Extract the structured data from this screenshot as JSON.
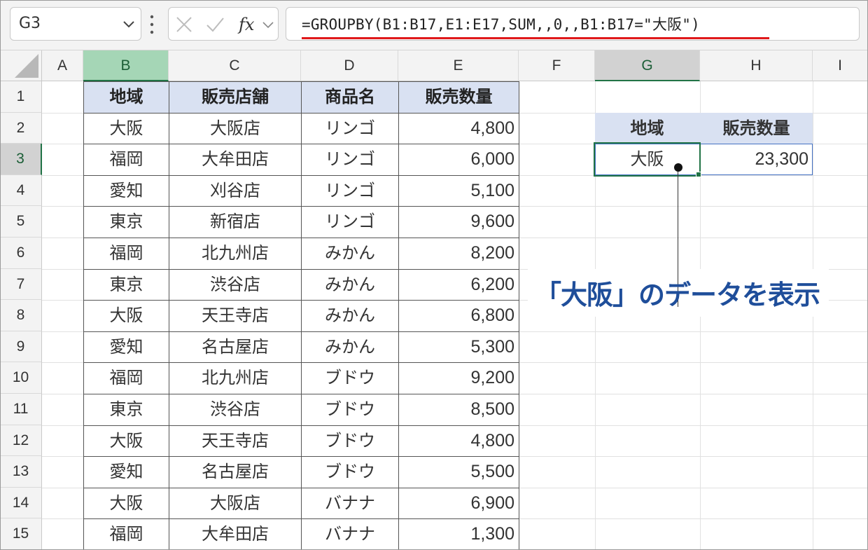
{
  "formula_bar": {
    "name_box": "G3",
    "formula": "=GROUPBY(B1:B17,E1:E17,SUM,,0,,B1:B17=\"大阪\")",
    "cancel_icon": "close-icon",
    "enter_icon": "check-icon",
    "fx_icon": "fx-icon"
  },
  "columns": [
    "A",
    "B",
    "C",
    "D",
    "E",
    "F",
    "G",
    "H",
    "I"
  ],
  "rows": [
    "1",
    "2",
    "3",
    "4",
    "5",
    "6",
    "7",
    "8",
    "9",
    "10",
    "11",
    "12",
    "13",
    "14",
    "15"
  ],
  "table": {
    "headers": [
      "地域",
      "販売店舗",
      "商品名",
      "販売数量"
    ],
    "rows": [
      [
        "大阪",
        "大阪店",
        "リンゴ",
        "4,800"
      ],
      [
        "福岡",
        "大牟田店",
        "リンゴ",
        "6,000"
      ],
      [
        "愛知",
        "刈谷店",
        "リンゴ",
        "5,100"
      ],
      [
        "東京",
        "新宿店",
        "リンゴ",
        "9,600"
      ],
      [
        "福岡",
        "北九州店",
        "みかん",
        "8,200"
      ],
      [
        "東京",
        "渋谷店",
        "みかん",
        "6,200"
      ],
      [
        "大阪",
        "天王寺店",
        "みかん",
        "6,800"
      ],
      [
        "愛知",
        "名古屋店",
        "みかん",
        "5,300"
      ],
      [
        "福岡",
        "北九州店",
        "ブドウ",
        "9,200"
      ],
      [
        "東京",
        "渋谷店",
        "ブドウ",
        "8,500"
      ],
      [
        "大阪",
        "天王寺店",
        "ブドウ",
        "4,800"
      ],
      [
        "愛知",
        "名古屋店",
        "ブドウ",
        "5,500"
      ],
      [
        "大阪",
        "大阪店",
        "バナナ",
        "6,900"
      ],
      [
        "福岡",
        "大牟田店",
        "バナナ",
        "1,300"
      ]
    ]
  },
  "result": {
    "headers": [
      "地域",
      "販売数量"
    ],
    "row": [
      "大阪",
      "23,300"
    ]
  },
  "annotation": "「大阪」のデータを表示",
  "colors": {
    "selected_col_header": "#a5d6b6",
    "header_fill": "#d9e1f2",
    "annotation_text": "#1f4e9a",
    "formula_underline": "#e0191b",
    "active_cell_border": "#217346"
  }
}
